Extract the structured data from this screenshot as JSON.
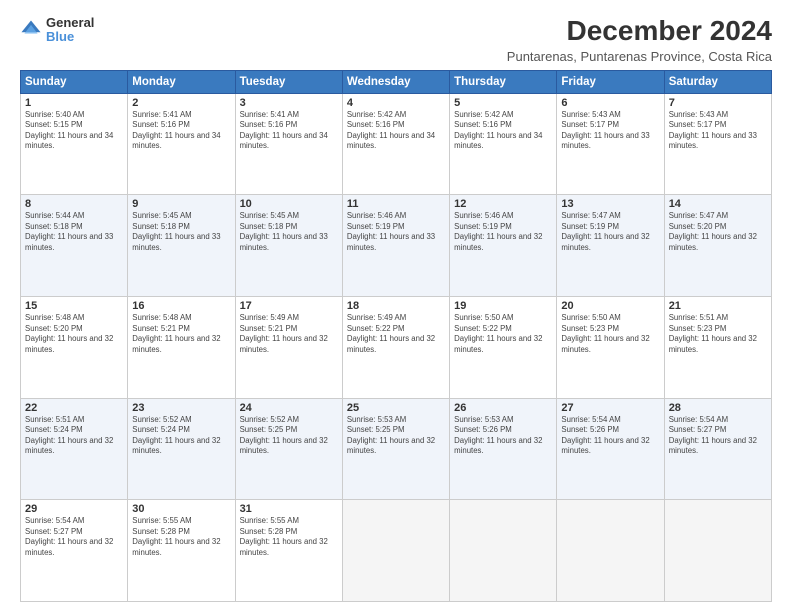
{
  "header": {
    "logo": {
      "general": "General",
      "blue": "Blue"
    },
    "title": "December 2024",
    "subtitle": "Puntarenas, Puntarenas Province, Costa Rica"
  },
  "days_of_week": [
    "Sunday",
    "Monday",
    "Tuesday",
    "Wednesday",
    "Thursday",
    "Friday",
    "Saturday"
  ],
  "weeks": [
    [
      {
        "day": 1,
        "sunrise": "5:40 AM",
        "sunset": "5:15 PM",
        "daylight": "11 hours and 34 minutes."
      },
      {
        "day": 2,
        "sunrise": "5:41 AM",
        "sunset": "5:16 PM",
        "daylight": "11 hours and 34 minutes."
      },
      {
        "day": 3,
        "sunrise": "5:41 AM",
        "sunset": "5:16 PM",
        "daylight": "11 hours and 34 minutes."
      },
      {
        "day": 4,
        "sunrise": "5:42 AM",
        "sunset": "5:16 PM",
        "daylight": "11 hours and 34 minutes."
      },
      {
        "day": 5,
        "sunrise": "5:42 AM",
        "sunset": "5:16 PM",
        "daylight": "11 hours and 34 minutes."
      },
      {
        "day": 6,
        "sunrise": "5:43 AM",
        "sunset": "5:17 PM",
        "daylight": "11 hours and 33 minutes."
      },
      {
        "day": 7,
        "sunrise": "5:43 AM",
        "sunset": "5:17 PM",
        "daylight": "11 hours and 33 minutes."
      }
    ],
    [
      {
        "day": 8,
        "sunrise": "5:44 AM",
        "sunset": "5:18 PM",
        "daylight": "11 hours and 33 minutes."
      },
      {
        "day": 9,
        "sunrise": "5:45 AM",
        "sunset": "5:18 PM",
        "daylight": "11 hours and 33 minutes."
      },
      {
        "day": 10,
        "sunrise": "5:45 AM",
        "sunset": "5:18 PM",
        "daylight": "11 hours and 33 minutes."
      },
      {
        "day": 11,
        "sunrise": "5:46 AM",
        "sunset": "5:19 PM",
        "daylight": "11 hours and 33 minutes."
      },
      {
        "day": 12,
        "sunrise": "5:46 AM",
        "sunset": "5:19 PM",
        "daylight": "11 hours and 32 minutes."
      },
      {
        "day": 13,
        "sunrise": "5:47 AM",
        "sunset": "5:19 PM",
        "daylight": "11 hours and 32 minutes."
      },
      {
        "day": 14,
        "sunrise": "5:47 AM",
        "sunset": "5:20 PM",
        "daylight": "11 hours and 32 minutes."
      }
    ],
    [
      {
        "day": 15,
        "sunrise": "5:48 AM",
        "sunset": "5:20 PM",
        "daylight": "11 hours and 32 minutes."
      },
      {
        "day": 16,
        "sunrise": "5:48 AM",
        "sunset": "5:21 PM",
        "daylight": "11 hours and 32 minutes."
      },
      {
        "day": 17,
        "sunrise": "5:49 AM",
        "sunset": "5:21 PM",
        "daylight": "11 hours and 32 minutes."
      },
      {
        "day": 18,
        "sunrise": "5:49 AM",
        "sunset": "5:22 PM",
        "daylight": "11 hours and 32 minutes."
      },
      {
        "day": 19,
        "sunrise": "5:50 AM",
        "sunset": "5:22 PM",
        "daylight": "11 hours and 32 minutes."
      },
      {
        "day": 20,
        "sunrise": "5:50 AM",
        "sunset": "5:23 PM",
        "daylight": "11 hours and 32 minutes."
      },
      {
        "day": 21,
        "sunrise": "5:51 AM",
        "sunset": "5:23 PM",
        "daylight": "11 hours and 32 minutes."
      }
    ],
    [
      {
        "day": 22,
        "sunrise": "5:51 AM",
        "sunset": "5:24 PM",
        "daylight": "11 hours and 32 minutes."
      },
      {
        "day": 23,
        "sunrise": "5:52 AM",
        "sunset": "5:24 PM",
        "daylight": "11 hours and 32 minutes."
      },
      {
        "day": 24,
        "sunrise": "5:52 AM",
        "sunset": "5:25 PM",
        "daylight": "11 hours and 32 minutes."
      },
      {
        "day": 25,
        "sunrise": "5:53 AM",
        "sunset": "5:25 PM",
        "daylight": "11 hours and 32 minutes."
      },
      {
        "day": 26,
        "sunrise": "5:53 AM",
        "sunset": "5:26 PM",
        "daylight": "11 hours and 32 minutes."
      },
      {
        "day": 27,
        "sunrise": "5:54 AM",
        "sunset": "5:26 PM",
        "daylight": "11 hours and 32 minutes."
      },
      {
        "day": 28,
        "sunrise": "5:54 AM",
        "sunset": "5:27 PM",
        "daylight": "11 hours and 32 minutes."
      }
    ],
    [
      {
        "day": 29,
        "sunrise": "5:54 AM",
        "sunset": "5:27 PM",
        "daylight": "11 hours and 32 minutes."
      },
      {
        "day": 30,
        "sunrise": "5:55 AM",
        "sunset": "5:28 PM",
        "daylight": "11 hours and 32 minutes."
      },
      {
        "day": 31,
        "sunrise": "5:55 AM",
        "sunset": "5:28 PM",
        "daylight": "11 hours and 32 minutes."
      },
      null,
      null,
      null,
      null
    ]
  ]
}
